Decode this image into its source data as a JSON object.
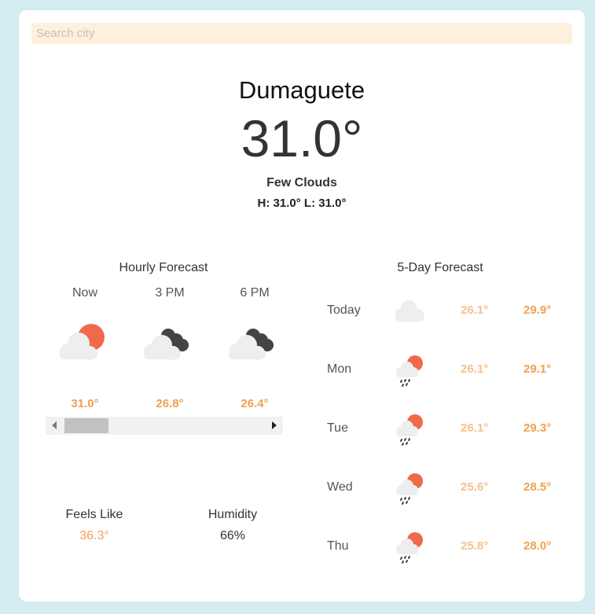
{
  "search": {
    "placeholder": "Search city",
    "value": ""
  },
  "current": {
    "city": "Dumaguete",
    "temp": "31.0°",
    "condition": "Few Clouds",
    "high_label": "H:",
    "high": "31.0°",
    "low_label": "L:",
    "low": "31.0°"
  },
  "hourly": {
    "title": "Hourly Forecast",
    "items": [
      {
        "time": "Now",
        "temp": "31.0°",
        "icon": "sun-behind-cloud-icon"
      },
      {
        "time": "3 PM",
        "temp": "26.8°",
        "icon": "dark-clouds-icon"
      },
      {
        "time": "6 PM",
        "temp": "26.4°",
        "icon": "dark-clouds-icon"
      }
    ],
    "scroll_position": 0
  },
  "stats": {
    "feels_like_label": "Feels Like",
    "feels_like": "36.3°",
    "humidity_label": "Humidity",
    "humidity": "66%"
  },
  "daily": {
    "title": "5-Day Forecast",
    "items": [
      {
        "day": "Today",
        "low": "26.1°",
        "high": "29.9°",
        "icon": "cloud-icon"
      },
      {
        "day": "Mon",
        "low": "26.1°",
        "high": "29.1°",
        "icon": "sun-cloud-rain-icon"
      },
      {
        "day": "Tue",
        "low": "26.1°",
        "high": "29.3°",
        "icon": "sun-cloud-rain-icon"
      },
      {
        "day": "Wed",
        "low": "25.6°",
        "high": "28.5°",
        "icon": "sun-cloud-rain-icon"
      },
      {
        "day": "Thu",
        "low": "25.8°",
        "high": "28.0°",
        "icon": "sun-cloud-rain-icon"
      }
    ]
  },
  "colors": {
    "background": "#d2ecef",
    "accent_orange": "#f0a050",
    "light_orange": "#f7c08a",
    "sun": "#ee6a4a",
    "dark_cloud": "#444444",
    "cloud": "#eeeeee",
    "search_bg": "#fdf0dc"
  }
}
